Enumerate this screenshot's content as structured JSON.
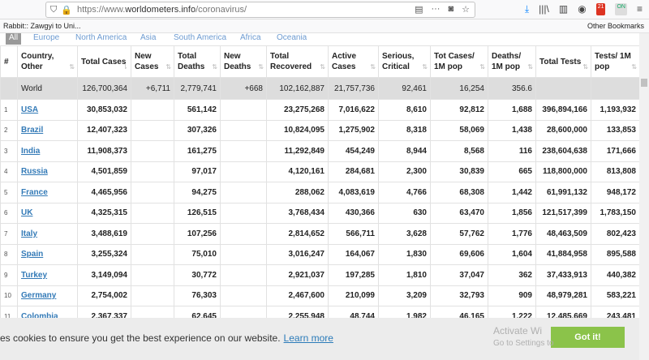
{
  "browser": {
    "url_prefix": "https://www.",
    "url_domain": "worldometers.info",
    "url_path": "/coronavirus/",
    "bookmark_label": "Rabbit:: Zawgyi to Uni...",
    "other_bookmarks": "Other Bookmarks",
    "ext_badge": "21",
    "ext_on": "ON"
  },
  "tabs": [
    "All",
    "Europe",
    "North America",
    "Asia",
    "South America",
    "Africa",
    "Oceania"
  ],
  "headers": [
    "#",
    "Country, Other",
    "Total Cases",
    "New Cases",
    "Total Deaths",
    "New Deaths",
    "Total Recovered",
    "Active Cases",
    "Serious, Critical",
    "Tot Cases/ 1M pop",
    "Deaths/ 1M pop",
    "Total Tests",
    "Tests/ 1M pop"
  ],
  "world": [
    "",
    "World",
    "126,700,364",
    "+6,711",
    "2,779,741",
    "+668",
    "102,162,887",
    "21,757,736",
    "92,461",
    "16,254",
    "356.6",
    "",
    ""
  ],
  "rows": [
    [
      "1",
      "USA",
      "30,853,032",
      "",
      "561,142",
      "",
      "23,275,268",
      "7,016,622",
      "8,610",
      "92,812",
      "1,688",
      "396,894,166",
      "1,193,932"
    ],
    [
      "2",
      "Brazil",
      "12,407,323",
      "",
      "307,326",
      "",
      "10,824,095",
      "1,275,902",
      "8,318",
      "58,069",
      "1,438",
      "28,600,000",
      "133,853"
    ],
    [
      "3",
      "India",
      "11,908,373",
      "",
      "161,275",
      "",
      "11,292,849",
      "454,249",
      "8,944",
      "8,568",
      "116",
      "238,604,638",
      "171,666"
    ],
    [
      "4",
      "Russia",
      "4,501,859",
      "",
      "97,017",
      "",
      "4,120,161",
      "284,681",
      "2,300",
      "30,839",
      "665",
      "118,800,000",
      "813,808"
    ],
    [
      "5",
      "France",
      "4,465,956",
      "",
      "94,275",
      "",
      "288,062",
      "4,083,619",
      "4,766",
      "68,308",
      "1,442",
      "61,991,132",
      "948,172"
    ],
    [
      "6",
      "UK",
      "4,325,315",
      "",
      "126,515",
      "",
      "3,768,434",
      "430,366",
      "630",
      "63,470",
      "1,856",
      "121,517,399",
      "1,783,150"
    ],
    [
      "7",
      "Italy",
      "3,488,619",
      "",
      "107,256",
      "",
      "2,814,652",
      "566,711",
      "3,628",
      "57,762",
      "1,776",
      "48,463,509",
      "802,423"
    ],
    [
      "8",
      "Spain",
      "3,255,324",
      "",
      "75,010",
      "",
      "3,016,247",
      "164,067",
      "1,830",
      "69,606",
      "1,604",
      "41,884,958",
      "895,588"
    ],
    [
      "9",
      "Turkey",
      "3,149,094",
      "",
      "30,772",
      "",
      "2,921,037",
      "197,285",
      "1,810",
      "37,047",
      "362",
      "37,433,913",
      "440,382"
    ],
    [
      "10",
      "Germany",
      "2,754,002",
      "",
      "76,303",
      "",
      "2,467,600",
      "210,099",
      "3,209",
      "32,793",
      "909",
      "48,979,281",
      "583,221"
    ],
    [
      "11",
      "Colombia",
      "2,367,337",
      "",
      "62,645",
      "",
      "2,255,948",
      "48,744",
      "1,982",
      "46,165",
      "1,222",
      "12,485,669",
      "243,481"
    ]
  ],
  "cookie": {
    "text": "es cookies to ensure you get the best experience on our website.",
    "link": "Learn more",
    "button": "Got it!"
  },
  "watermark": {
    "title": "Activate Wi",
    "subtitle": "Go to Settings to"
  }
}
